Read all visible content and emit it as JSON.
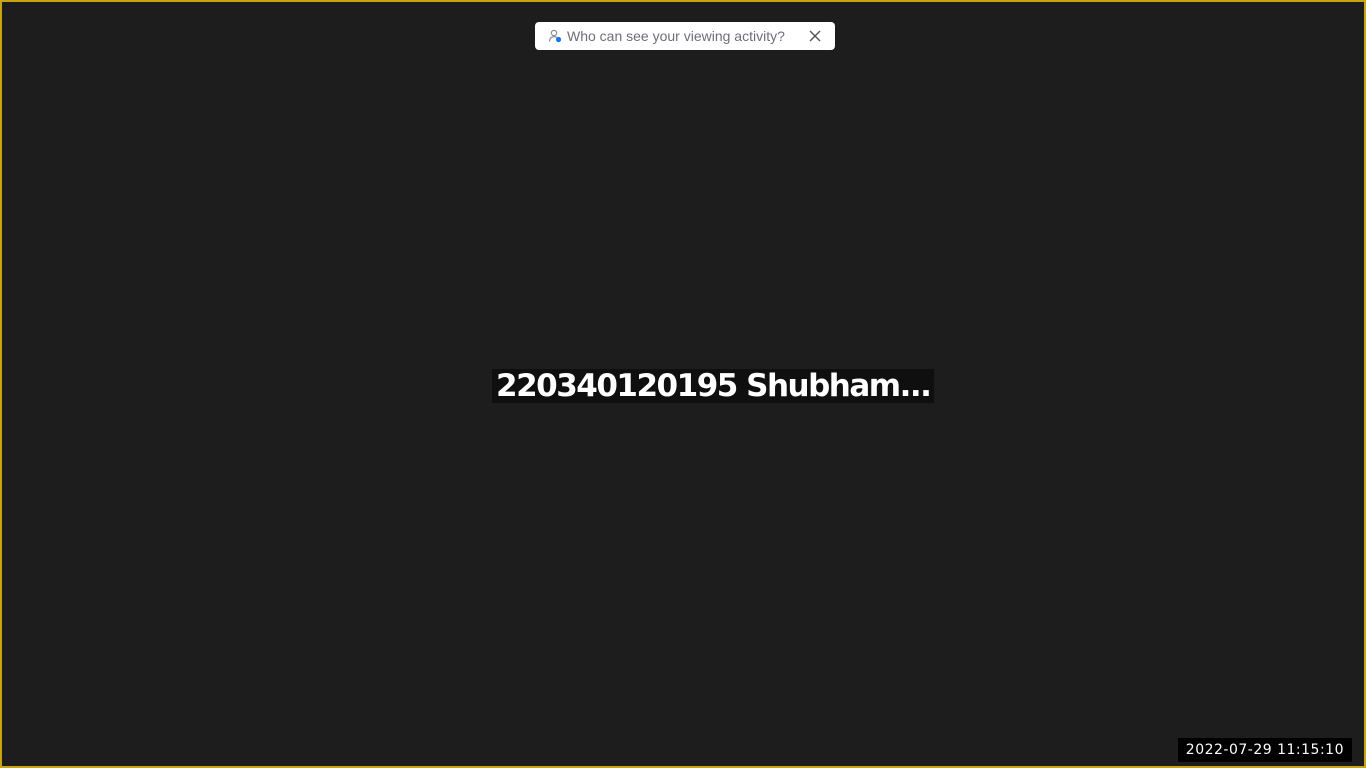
{
  "banner": {
    "text": "Who can see your viewing activity?",
    "icon": "person-eye-icon",
    "close_icon": "close-icon"
  },
  "video": {
    "participant_name": "220340120195 Shubham..."
  },
  "overlay": {
    "timestamp": "2022-07-29  11:15:10"
  },
  "colors": {
    "frame_border": "#c9a411",
    "background": "#1d1d1d",
    "badge_accent": "#1a73e8"
  }
}
